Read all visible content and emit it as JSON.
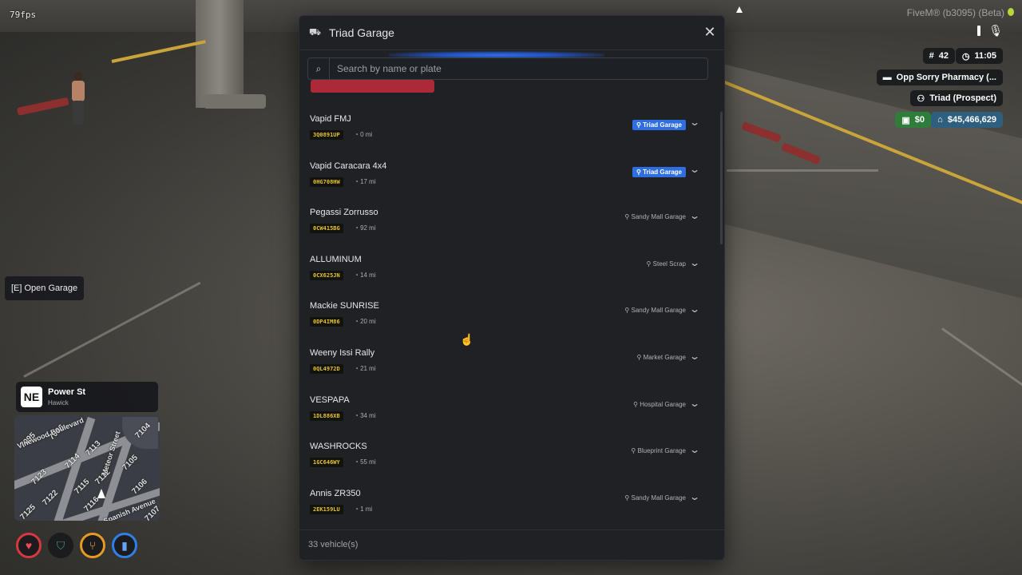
{
  "hud": {
    "fps": "79fps",
    "fivem": "FiveM® (b3095) (Beta)",
    "server_id": "42",
    "time": "11:05",
    "job": "Opp Sorry Pharmacy (...",
    "gang": "Triad (Prospect)",
    "cash": "$0",
    "bank": "$45,466,629",
    "prompt": "[E] Open Garage"
  },
  "location": {
    "direction": "NE",
    "street": "Power St",
    "area": "Hawick"
  },
  "minimap": {
    "labels": [
      "7095",
      "7096",
      "7113",
      "Vinewood Boulevard",
      "7114",
      "7123",
      "7115",
      "7112",
      "7116",
      "7122",
      "7105",
      "7106",
      "7104",
      "Meteor Street",
      "Spanish Avenue",
      "7125",
      "7107"
    ]
  },
  "garage": {
    "title": "Triad Garage",
    "search_placeholder": "Search by name or plate",
    "footer": "33 vehicle(s)",
    "vehicles": [
      {
        "name": "Vapid FMJ",
        "plate": "3Q0891UP",
        "distance": "0 mi",
        "location": "Triad Garage",
        "current": true
      },
      {
        "name": "Vapid Caracara 4x4",
        "plate": "0HG708HW",
        "distance": "17 mi",
        "location": "Triad Garage",
        "current": true
      },
      {
        "name": "Pegassi Zorrusso",
        "plate": "0CW415BG",
        "distance": "92 mi",
        "location": "Sandy Mall Garage",
        "current": false
      },
      {
        "name": "ALLUMINUM",
        "plate": "0CX625JN",
        "distance": "14 mi",
        "location": "Steel Scrap",
        "current": false
      },
      {
        "name": "Mackie SUNRISE",
        "plate": "0DP4IM86",
        "distance": "20 mi",
        "location": "Sandy Mall Garage",
        "current": false
      },
      {
        "name": "Weeny Issi Rally",
        "plate": "0QL4972D",
        "distance": "21 mi",
        "location": "Market Garage",
        "current": false
      },
      {
        "name": "VESPAPA",
        "plate": "1DL886XB",
        "distance": "34 mi",
        "location": "Hospital Garage",
        "current": false
      },
      {
        "name": "WASHROCKS",
        "plate": "1GC646WY",
        "distance": "55 mi",
        "location": "Blueprint Garage",
        "current": false
      },
      {
        "name": "Annis ZR350",
        "plate": "2EK159LU",
        "distance": "1 mi",
        "location": "Sandy Mall Garage",
        "current": false
      }
    ]
  },
  "colors": {
    "accent": "#2f6ee0",
    "plate_text": "#e9c230",
    "health": "#d6383f",
    "hunger": "#e79a22",
    "thirst": "#2f7fe6"
  }
}
